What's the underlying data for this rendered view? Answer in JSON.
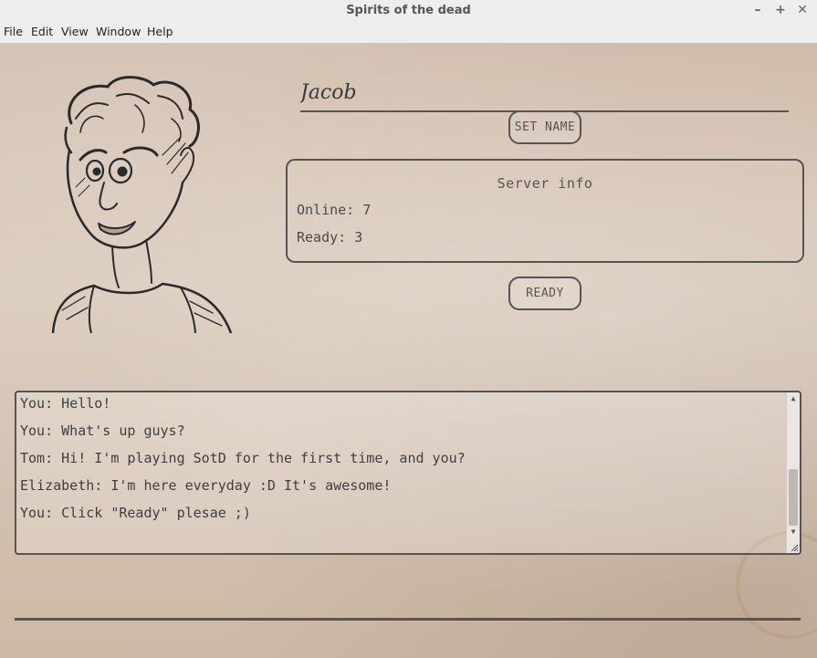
{
  "window": {
    "title": "Spirits of the dead",
    "controls": {
      "minimize": "–",
      "maximize": "+",
      "close": "✕"
    }
  },
  "menu": [
    "File",
    "Edit",
    "View",
    "Window",
    "Help"
  ],
  "profile": {
    "name_value": "Jacob",
    "set_name_label": "SET NAME"
  },
  "server": {
    "title": "Server info",
    "online": "Online: 7",
    "ready": "Ready: 3"
  },
  "ready_button_label": "READY",
  "chat": {
    "lines": [
      "You: Hello!",
      "You: What's up guys?",
      "Tom: Hi! I'm playing SotD for the first time, and you?",
      "Elizabeth: I'm here everyday :D It's awesome!",
      "You: Click \"Ready\" plesae ;)"
    ],
    "scroll_up": "▲",
    "scroll_down": "▼"
  },
  "icons": {
    "portrait": "sketch-portrait-icon",
    "resize": "resize-grip-icon"
  },
  "colors": {
    "parchment": "#d4c2b1",
    "ink": "#555555"
  }
}
